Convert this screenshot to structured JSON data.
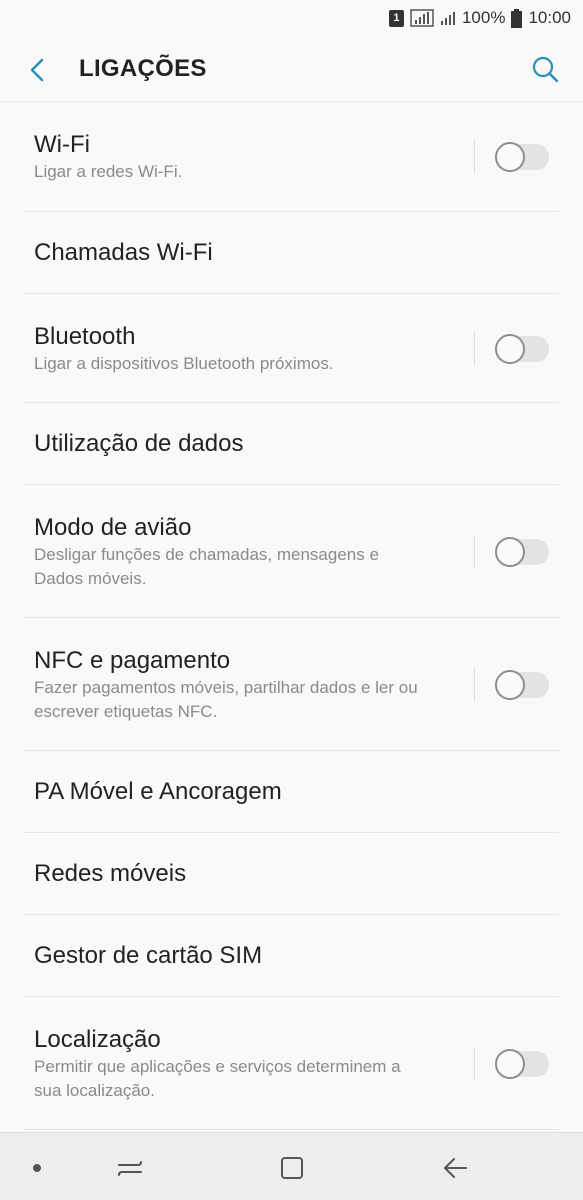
{
  "status_bar": {
    "sim_slot": "1",
    "battery": "100%",
    "time": "10:00"
  },
  "header": {
    "title": "LIGAÇÕES",
    "back_icon": "back-arrow-icon",
    "search_icon": "search-icon"
  },
  "items": [
    {
      "title": "Wi-Fi",
      "subtitle": "Ligar a redes Wi-Fi.",
      "toggle": true,
      "on": false
    },
    {
      "title": "Chamadas Wi-Fi",
      "subtitle": "",
      "toggle": false
    },
    {
      "title": "Bluetooth",
      "subtitle": "Ligar a dispositivos Bluetooth próximos.",
      "toggle": true,
      "on": false
    },
    {
      "title": "Utilização de dados",
      "subtitle": "",
      "toggle": false
    },
    {
      "title": "Modo de avião",
      "subtitle": "Desligar funções de chamadas, mensagens e Dados móveis.",
      "toggle": true,
      "on": false
    },
    {
      "title": "NFC e pagamento",
      "subtitle": "Fazer pagamentos móveis, partilhar dados e ler ou escrever etiquetas NFC.",
      "toggle": true,
      "on": false
    },
    {
      "title": "PA Móvel e Ancoragem",
      "subtitle": "",
      "toggle": false
    },
    {
      "title": "Redes móveis",
      "subtitle": "",
      "toggle": false
    },
    {
      "title": "Gestor de cartão SIM",
      "subtitle": "",
      "toggle": false
    },
    {
      "title": "Localização",
      "subtitle": "Permitir que aplicações e serviços determinem a sua localização.",
      "toggle": true,
      "on": false
    }
  ],
  "nav_bar": {
    "icons": [
      "dot-icon",
      "recents-icon",
      "home-icon",
      "back-icon"
    ]
  }
}
